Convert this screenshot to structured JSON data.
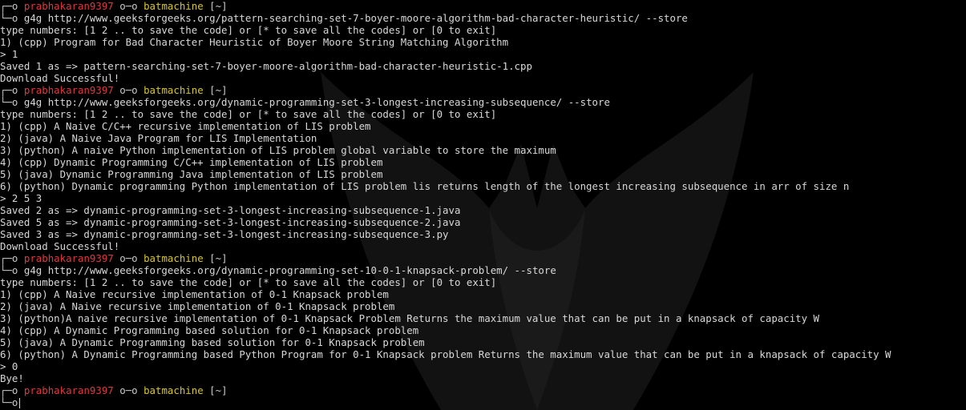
{
  "prompt": {
    "user": "prabhakaran9397",
    "link": "o─o",
    "host": "batmachine",
    "dir": "[~]",
    "top_corner": "┌─o",
    "bottom_corner": "└─o"
  },
  "lines": [
    {
      "type": "prompt"
    },
    {
      "type": "cmd",
      "text": "g4g http://www.geeksforgeeks.org/pattern-searching-set-7-boyer-moore-algorithm-bad-character-heuristic/ --store"
    },
    {
      "type": "out",
      "text": "type numbers: [1 2 .. to save the code] or [* to save all the codes] or [0 to exit]"
    },
    {
      "type": "out",
      "text": "1) (cpp) Program for Bad Character Heuristic of Boyer Moore String Matching Algorithm"
    },
    {
      "type": "out",
      "text": "> 1"
    },
    {
      "type": "out",
      "text": "Saved 1 as => pattern-searching-set-7-boyer-moore-algorithm-bad-character-heuristic-1.cpp"
    },
    {
      "type": "out",
      "text": "Download Successful!"
    },
    {
      "type": "prompt"
    },
    {
      "type": "cmd",
      "text": "g4g http://www.geeksforgeeks.org/dynamic-programming-set-3-longest-increasing-subsequence/ --store"
    },
    {
      "type": "out",
      "text": "type numbers: [1 2 .. to save the code] or [* to save all the codes] or [0 to exit]"
    },
    {
      "type": "out",
      "text": "1) (cpp) A Naive C/C++ recursive implementation of LIS problem"
    },
    {
      "type": "out",
      "text": "2) (java) A Naive Java Program for LIS Implementation"
    },
    {
      "type": "out",
      "text": "3) (python) A naive Python implementation of LIS problem global variable to store the maximum"
    },
    {
      "type": "out",
      "text": "4) (cpp) Dynamic Programming C/C++ implementation of LIS problem"
    },
    {
      "type": "out",
      "text": "5) (java) Dynamic Programming Java implementation of LIS problem"
    },
    {
      "type": "out",
      "text": "6) (python) Dynamic programming Python implementation of LIS problem lis returns length of the longest increasing subsequence in arr of size n"
    },
    {
      "type": "out",
      "text": "> 2 5 3"
    },
    {
      "type": "out",
      "text": "Saved 2 as => dynamic-programming-set-3-longest-increasing-subsequence-1.java"
    },
    {
      "type": "out",
      "text": "Saved 5 as => dynamic-programming-set-3-longest-increasing-subsequence-2.java"
    },
    {
      "type": "out",
      "text": "Saved 3 as => dynamic-programming-set-3-longest-increasing-subsequence-3.py"
    },
    {
      "type": "out",
      "text": "Download Successful!"
    },
    {
      "type": "prompt"
    },
    {
      "type": "cmd",
      "text": "g4g http://www.geeksforgeeks.org/dynamic-programming-set-10-0-1-knapsack-problem/ --store"
    },
    {
      "type": "out",
      "text": "type numbers: [1 2 .. to save the code] or [* to save all the codes] or [0 to exit]"
    },
    {
      "type": "out",
      "text": "1) (cpp) A Naive recursive implementation of 0-1 Knapsack problem"
    },
    {
      "type": "out",
      "text": "2) (java) A Naive recursive implementation of 0-1 Knapsack problem"
    },
    {
      "type": "out",
      "text": "3) (python)A naive recursive implementation of 0-1 Knapsack Problem Returns the maximum value that can be put in a knapsack of capacity W"
    },
    {
      "type": "out",
      "text": "4) (cpp) A Dynamic Programming based solution for 0-1 Knapsack problem"
    },
    {
      "type": "out",
      "text": "5) (java) A Dynamic Programming based solution for 0-1 Knapsack problem"
    },
    {
      "type": "out",
      "text": "6) (python) A Dynamic Programming based Python Program for 0-1 Knapsack problem Returns the maximum value that can be put in a knapsack of capacity W"
    },
    {
      "type": "out",
      "text": "> 0"
    },
    {
      "type": "out",
      "text": "Bye!"
    },
    {
      "type": "prompt"
    },
    {
      "type": "input",
      "text": ""
    }
  ],
  "colors": {
    "background": "#000000",
    "text": "#d8d8d8",
    "user": "#e0373f",
    "host": "#d6c532"
  },
  "background_logo": "batman-logo-watermark"
}
